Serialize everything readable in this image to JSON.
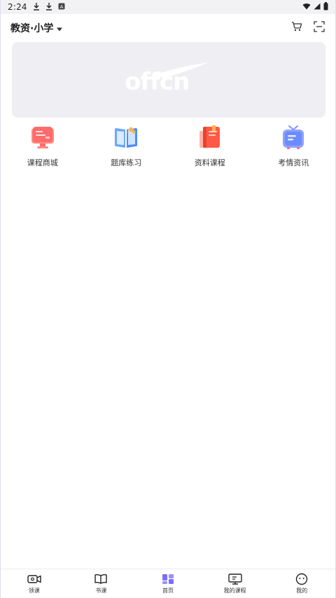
{
  "status_bar": {
    "time": "2:24",
    "icons": [
      "download-icon",
      "download-icon",
      "notification-a-icon",
      "wifi-icon",
      "signal-icon",
      "battery-icon"
    ]
  },
  "header": {
    "title": "教资·小学",
    "dropdown_icon": "caret-down-icon",
    "cart_icon": "cart-icon",
    "scan_icon": "scan-icon"
  },
  "banner": {
    "logo_text": "offcn"
  },
  "quick_menu": {
    "items": [
      {
        "label": "课程商城",
        "icon": "course-mall-icon",
        "color": "#ff6b6b"
      },
      {
        "label": "题库练习",
        "icon": "question-bank-icon",
        "color": "#4b8df8"
      },
      {
        "label": "资料课程",
        "icon": "materials-icon",
        "color": "#ff5a45"
      },
      {
        "label": "考情资讯",
        "icon": "exam-news-icon",
        "color": "#6b8cff"
      }
    ]
  },
  "bottom_nav": {
    "items": [
      {
        "label": "领课",
        "icon": "video-icon"
      },
      {
        "label": "书课",
        "icon": "book-icon"
      },
      {
        "label": "首页",
        "icon": "home-grid-icon",
        "active": true
      },
      {
        "label": "我的课程",
        "icon": "monitor-icon"
      },
      {
        "label": "我的",
        "icon": "smile-icon"
      }
    ]
  },
  "colors": {
    "accent": "#7b6cff",
    "banner_bg": "#efeff3",
    "status_bar_bg": "#f2f2f5"
  }
}
